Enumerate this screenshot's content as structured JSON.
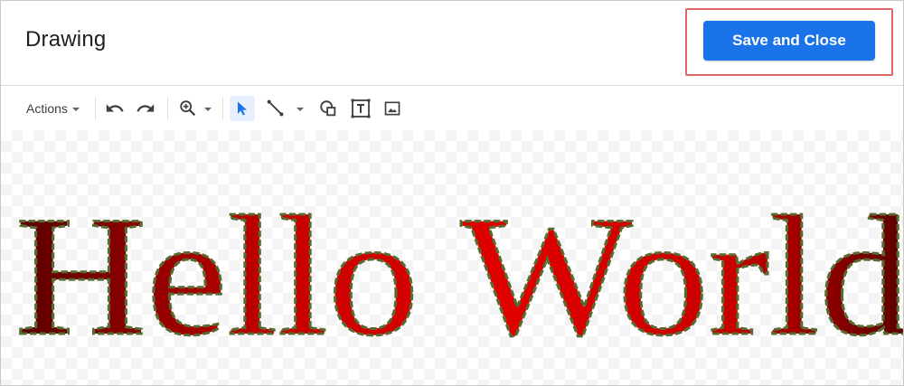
{
  "window": {
    "title": "Drawing",
    "save_button_label": "Save and Close"
  },
  "toolbar": {
    "actions_label": "Actions",
    "buttons": [
      "undo-icon",
      "redo-icon",
      "zoom-icon",
      "select-icon",
      "line-icon",
      "shape-icon",
      "text-box-icon",
      "image-icon"
    ]
  },
  "canvas": {
    "wordart_text": "Hello World",
    "fill_gradient": [
      "#5a0000",
      "#c80000",
      "#e00000",
      "#c80000",
      "#5a0000"
    ],
    "outline_color": "#556b2f"
  },
  "colors": {
    "accent": "#1a73e8",
    "highlight": "#e06666"
  }
}
